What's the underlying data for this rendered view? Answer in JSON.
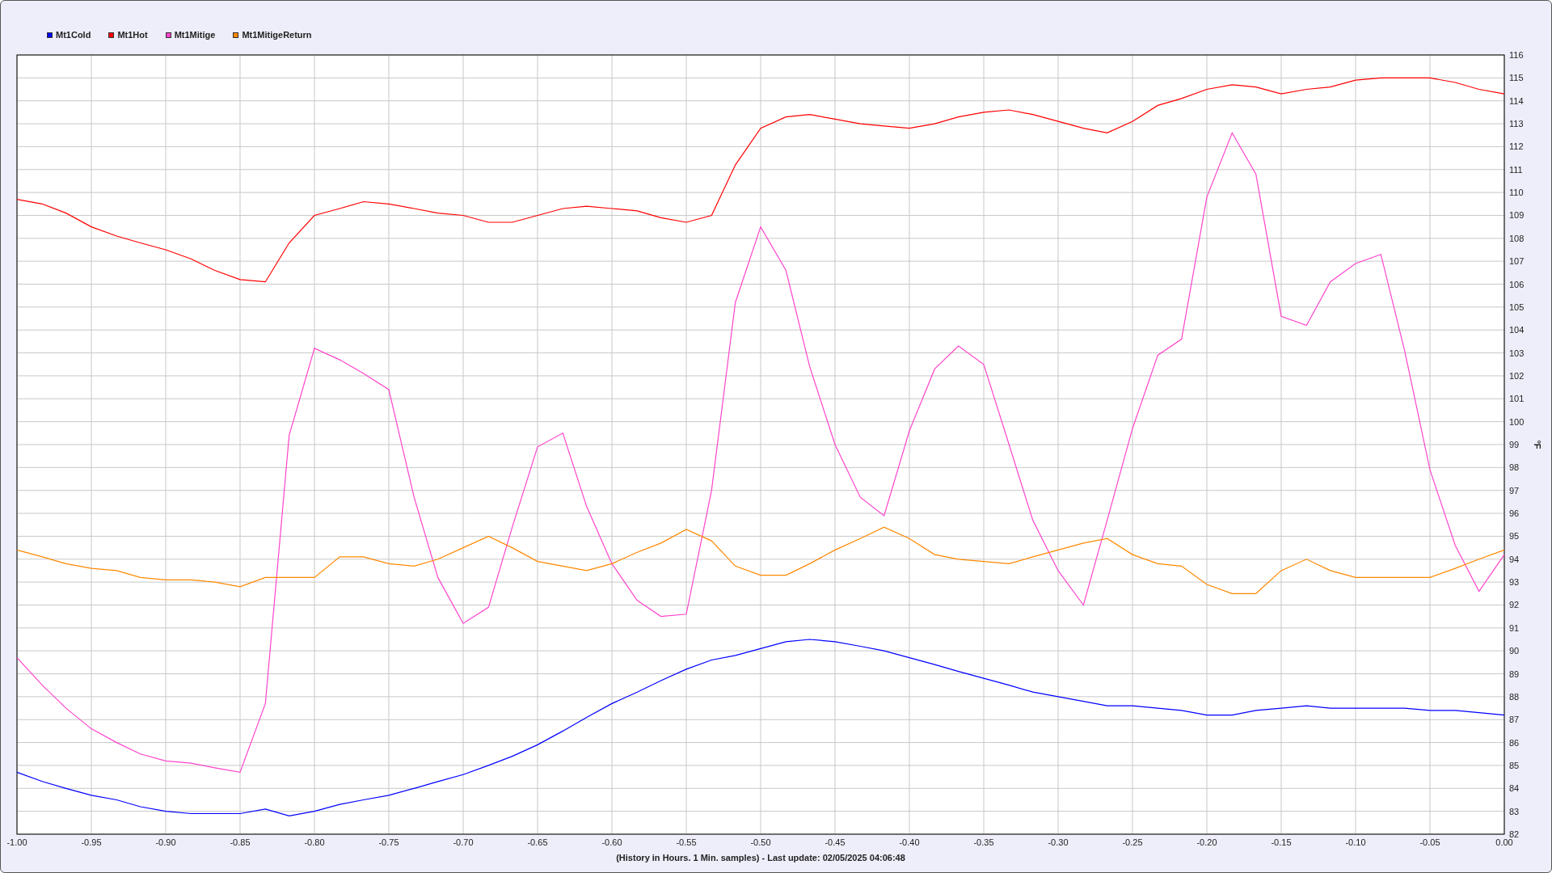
{
  "chart_data": {
    "type": "line",
    "grid": true,
    "xlabel": "(History in Hours. 1 Min. samples) - Last update: 02/05/2025 04:06:48",
    "ylabel": "°F",
    "x": [
      -1.0,
      -0.983,
      -0.967,
      -0.95,
      -0.933,
      -0.917,
      -0.9,
      -0.883,
      -0.867,
      -0.85,
      -0.833,
      -0.817,
      -0.8,
      -0.783,
      -0.767,
      -0.75,
      -0.733,
      -0.717,
      -0.7,
      -0.683,
      -0.667,
      -0.65,
      -0.633,
      -0.617,
      -0.6,
      -0.583,
      -0.567,
      -0.55,
      -0.533,
      -0.517,
      -0.5,
      -0.483,
      -0.467,
      -0.45,
      -0.433,
      -0.417,
      -0.4,
      -0.383,
      -0.367,
      -0.35,
      -0.333,
      -0.317,
      -0.3,
      -0.283,
      -0.267,
      -0.25,
      -0.233,
      -0.217,
      -0.2,
      -0.183,
      -0.167,
      -0.15,
      -0.133,
      -0.117,
      -0.1,
      -0.083,
      -0.067,
      -0.05,
      -0.033,
      -0.017,
      0.0
    ],
    "series": [
      {
        "name": "Mt1Cold",
        "color": "#0000ff",
        "values": [
          84.7,
          84.3,
          84.0,
          83.7,
          83.5,
          83.2,
          83.0,
          82.9,
          82.9,
          82.9,
          83.1,
          82.8,
          83.0,
          83.3,
          83.5,
          83.7,
          84.0,
          84.3,
          84.6,
          85.0,
          85.4,
          85.9,
          86.5,
          87.1,
          87.7,
          88.2,
          88.7,
          89.2,
          89.6,
          89.8,
          90.1,
          90.4,
          90.5,
          90.4,
          90.2,
          90.0,
          89.7,
          89.4,
          89.1,
          88.8,
          88.5,
          88.2,
          88.0,
          87.8,
          87.6,
          87.6,
          87.5,
          87.4,
          87.2,
          87.2,
          87.4,
          87.5,
          87.6,
          87.5,
          87.5,
          87.5,
          87.5,
          87.4,
          87.4,
          87.3,
          87.2
        ]
      },
      {
        "name": "Mt1Hot",
        "color": "#ff0000",
        "values": [
          109.7,
          109.5,
          109.1,
          108.5,
          108.1,
          107.8,
          107.5,
          107.1,
          106.6,
          106.2,
          106.1,
          107.8,
          109.0,
          109.3,
          109.6,
          109.5,
          109.3,
          109.1,
          109.0,
          108.7,
          108.7,
          109.0,
          109.3,
          109.4,
          109.3,
          109.2,
          108.9,
          108.7,
          109.0,
          111.2,
          112.8,
          113.3,
          113.4,
          113.2,
          113.0,
          112.9,
          112.8,
          113.0,
          113.3,
          113.5,
          113.6,
          113.4,
          113.1,
          112.8,
          112.6,
          113.1,
          113.8,
          114.1,
          114.5,
          114.7,
          114.6,
          114.3,
          114.5,
          114.6,
          114.9,
          115.0,
          115.0,
          115.0,
          114.8,
          114.5,
          114.3
        ]
      },
      {
        "name": "Mt1Mitige",
        "color": "#ff44cc",
        "values": [
          89.7,
          88.5,
          87.5,
          86.6,
          86.0,
          85.5,
          85.2,
          85.1,
          84.9,
          84.7,
          87.7,
          99.4,
          103.2,
          102.7,
          102.1,
          101.4,
          96.7,
          93.2,
          91.2,
          91.9,
          95.4,
          98.9,
          99.5,
          96.3,
          93.8,
          92.2,
          91.5,
          91.6,
          97.0,
          105.2,
          108.5,
          106.6,
          102.4,
          99.0,
          96.7,
          95.9,
          99.6,
          102.3,
          103.3,
          102.5,
          99.0,
          95.7,
          93.5,
          92.0,
          95.7,
          99.7,
          102.9,
          103.6,
          109.8,
          112.6,
          110.8,
          104.6,
          104.2,
          106.1,
          106.9,
          107.3,
          103.1,
          97.9,
          94.6,
          92.6,
          94.2
        ]
      },
      {
        "name": "Mt1MitigeReturn",
        "color": "#ff8800",
        "values": [
          94.4,
          94.1,
          93.8,
          93.6,
          93.5,
          93.2,
          93.1,
          93.1,
          93.0,
          92.8,
          93.2,
          93.2,
          93.2,
          94.1,
          94.1,
          93.8,
          93.7,
          94.0,
          94.5,
          95.0,
          94.5,
          93.9,
          93.7,
          93.5,
          93.8,
          94.3,
          94.7,
          95.3,
          94.8,
          93.7,
          93.3,
          93.3,
          93.8,
          94.4,
          94.9,
          95.4,
          94.9,
          94.2,
          94.0,
          93.9,
          93.8,
          94.1,
          94.4,
          94.7,
          94.9,
          94.2,
          93.8,
          93.7,
          92.9,
          92.5,
          92.5,
          93.5,
          94.0,
          93.5,
          93.2,
          93.2,
          93.2,
          93.2,
          93.6,
          94.0,
          94.4
        ]
      }
    ],
    "xlim": [
      -1.0,
      0.0
    ],
    "ylim": [
      82,
      116
    ],
    "xticks": [
      {
        "value": -1.0,
        "label": "-1.00"
      },
      {
        "value": -0.95,
        "label": "-0.95"
      },
      {
        "value": -0.9,
        "label": "-0.90"
      },
      {
        "value": -0.85,
        "label": "-0.85"
      },
      {
        "value": -0.8,
        "label": "-0.80"
      },
      {
        "value": -0.75,
        "label": "-0.75"
      },
      {
        "value": -0.7,
        "label": "-0.70"
      },
      {
        "value": -0.65,
        "label": "-0.65"
      },
      {
        "value": -0.6,
        "label": "-0.60"
      },
      {
        "value": -0.55,
        "label": "-0.55"
      },
      {
        "value": -0.5,
        "label": "-0.50"
      },
      {
        "value": -0.45,
        "label": "-0.45"
      },
      {
        "value": -0.4,
        "label": "-0.40"
      },
      {
        "value": -0.35,
        "label": "-0.35"
      },
      {
        "value": -0.3,
        "label": "-0.30"
      },
      {
        "value": -0.25,
        "label": "-0.25"
      },
      {
        "value": -0.2,
        "label": "-0.20"
      },
      {
        "value": -0.15,
        "label": "-0.15"
      },
      {
        "value": -0.1,
        "label": "-0.10"
      },
      {
        "value": -0.05,
        "label": "-0.05"
      },
      {
        "value": 0.0,
        "label": "0.00"
      }
    ],
    "yticks": [
      82,
      83,
      84,
      85,
      86,
      87,
      88,
      89,
      90,
      91,
      92,
      93,
      94,
      95,
      96,
      97,
      98,
      99,
      100,
      101,
      102,
      103,
      104,
      105,
      106,
      107,
      108,
      109,
      110,
      111,
      112,
      113,
      114,
      115,
      116
    ]
  }
}
